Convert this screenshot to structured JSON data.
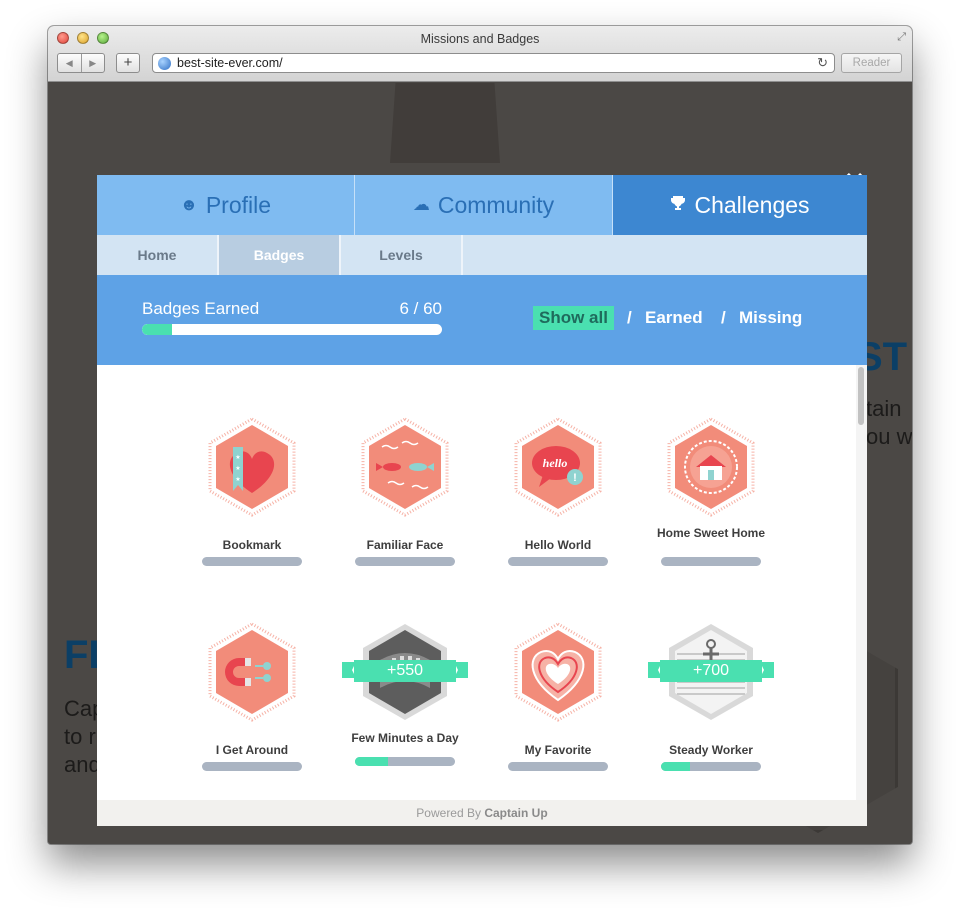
{
  "browser": {
    "window_title": "Missions and Badges",
    "url": "best-site-ever.com/",
    "reader_label": "Reader",
    "back_glyph": "◀",
    "forward_glyph": "▶",
    "newtab_glyph": "+",
    "reload_glyph": "↻",
    "resize_glyph": "⤢"
  },
  "background_page": {
    "heading_right": "ST",
    "text_right_1": "tain",
    "text_right_2": "ou w",
    "heading_left": "FL",
    "text_left_1": "Cap",
    "text_left_2": "to r",
    "text_left_3": "and"
  },
  "modal": {
    "close_glyph": "✕",
    "main_tabs": [
      {
        "label": "Profile",
        "icon": "face-icon",
        "glyph": "☻",
        "active": false
      },
      {
        "label": "Community",
        "icon": "group-icon",
        "glyph": "☁",
        "active": false
      },
      {
        "label": "Challenges",
        "icon": "trophy-icon",
        "glyph": "🏆",
        "active": true
      }
    ],
    "sub_tabs": [
      {
        "label": "Home",
        "active": false
      },
      {
        "label": "Badges",
        "active": true
      },
      {
        "label": "Levels",
        "active": false
      }
    ],
    "stats": {
      "label": "Badges Earned",
      "value": "6 / 60",
      "progress_fraction": 0.1
    },
    "filters": {
      "show_all": "Show all",
      "earned": "Earned",
      "missing": "Missing",
      "separator": "/"
    },
    "badges": [
      {
        "name": "Bookmark",
        "progress": 0,
        "earned": false,
        "reward": ""
      },
      {
        "name": "Familiar Face",
        "progress": 0,
        "earned": false,
        "reward": ""
      },
      {
        "name": "Hello World",
        "progress": 0,
        "earned": false,
        "reward": ""
      },
      {
        "name": "Home Sweet Home",
        "progress": 0,
        "earned": false,
        "reward": ""
      },
      {
        "name": "I Get Around",
        "progress": 0,
        "earned": false,
        "reward": ""
      },
      {
        "name": "Few Minutes a Day",
        "progress": 0.33,
        "earned": true,
        "reward": "+550"
      },
      {
        "name": "My Favorite",
        "progress": 0,
        "earned": false,
        "reward": ""
      },
      {
        "name": "Steady Worker",
        "progress": 0.29,
        "earned": true,
        "reward": "+700"
      }
    ],
    "badge_art_text": "hello",
    "footer_prefix": "Powered By",
    "footer_brand": "Captain Up"
  },
  "colors": {
    "badge_salmon": "#f28c7a",
    "badge_red": "#e8454f",
    "badge_teal": "#4ae0b0",
    "tab_blue": "#7fbbf1",
    "tab_active": "#3d87d1"
  }
}
